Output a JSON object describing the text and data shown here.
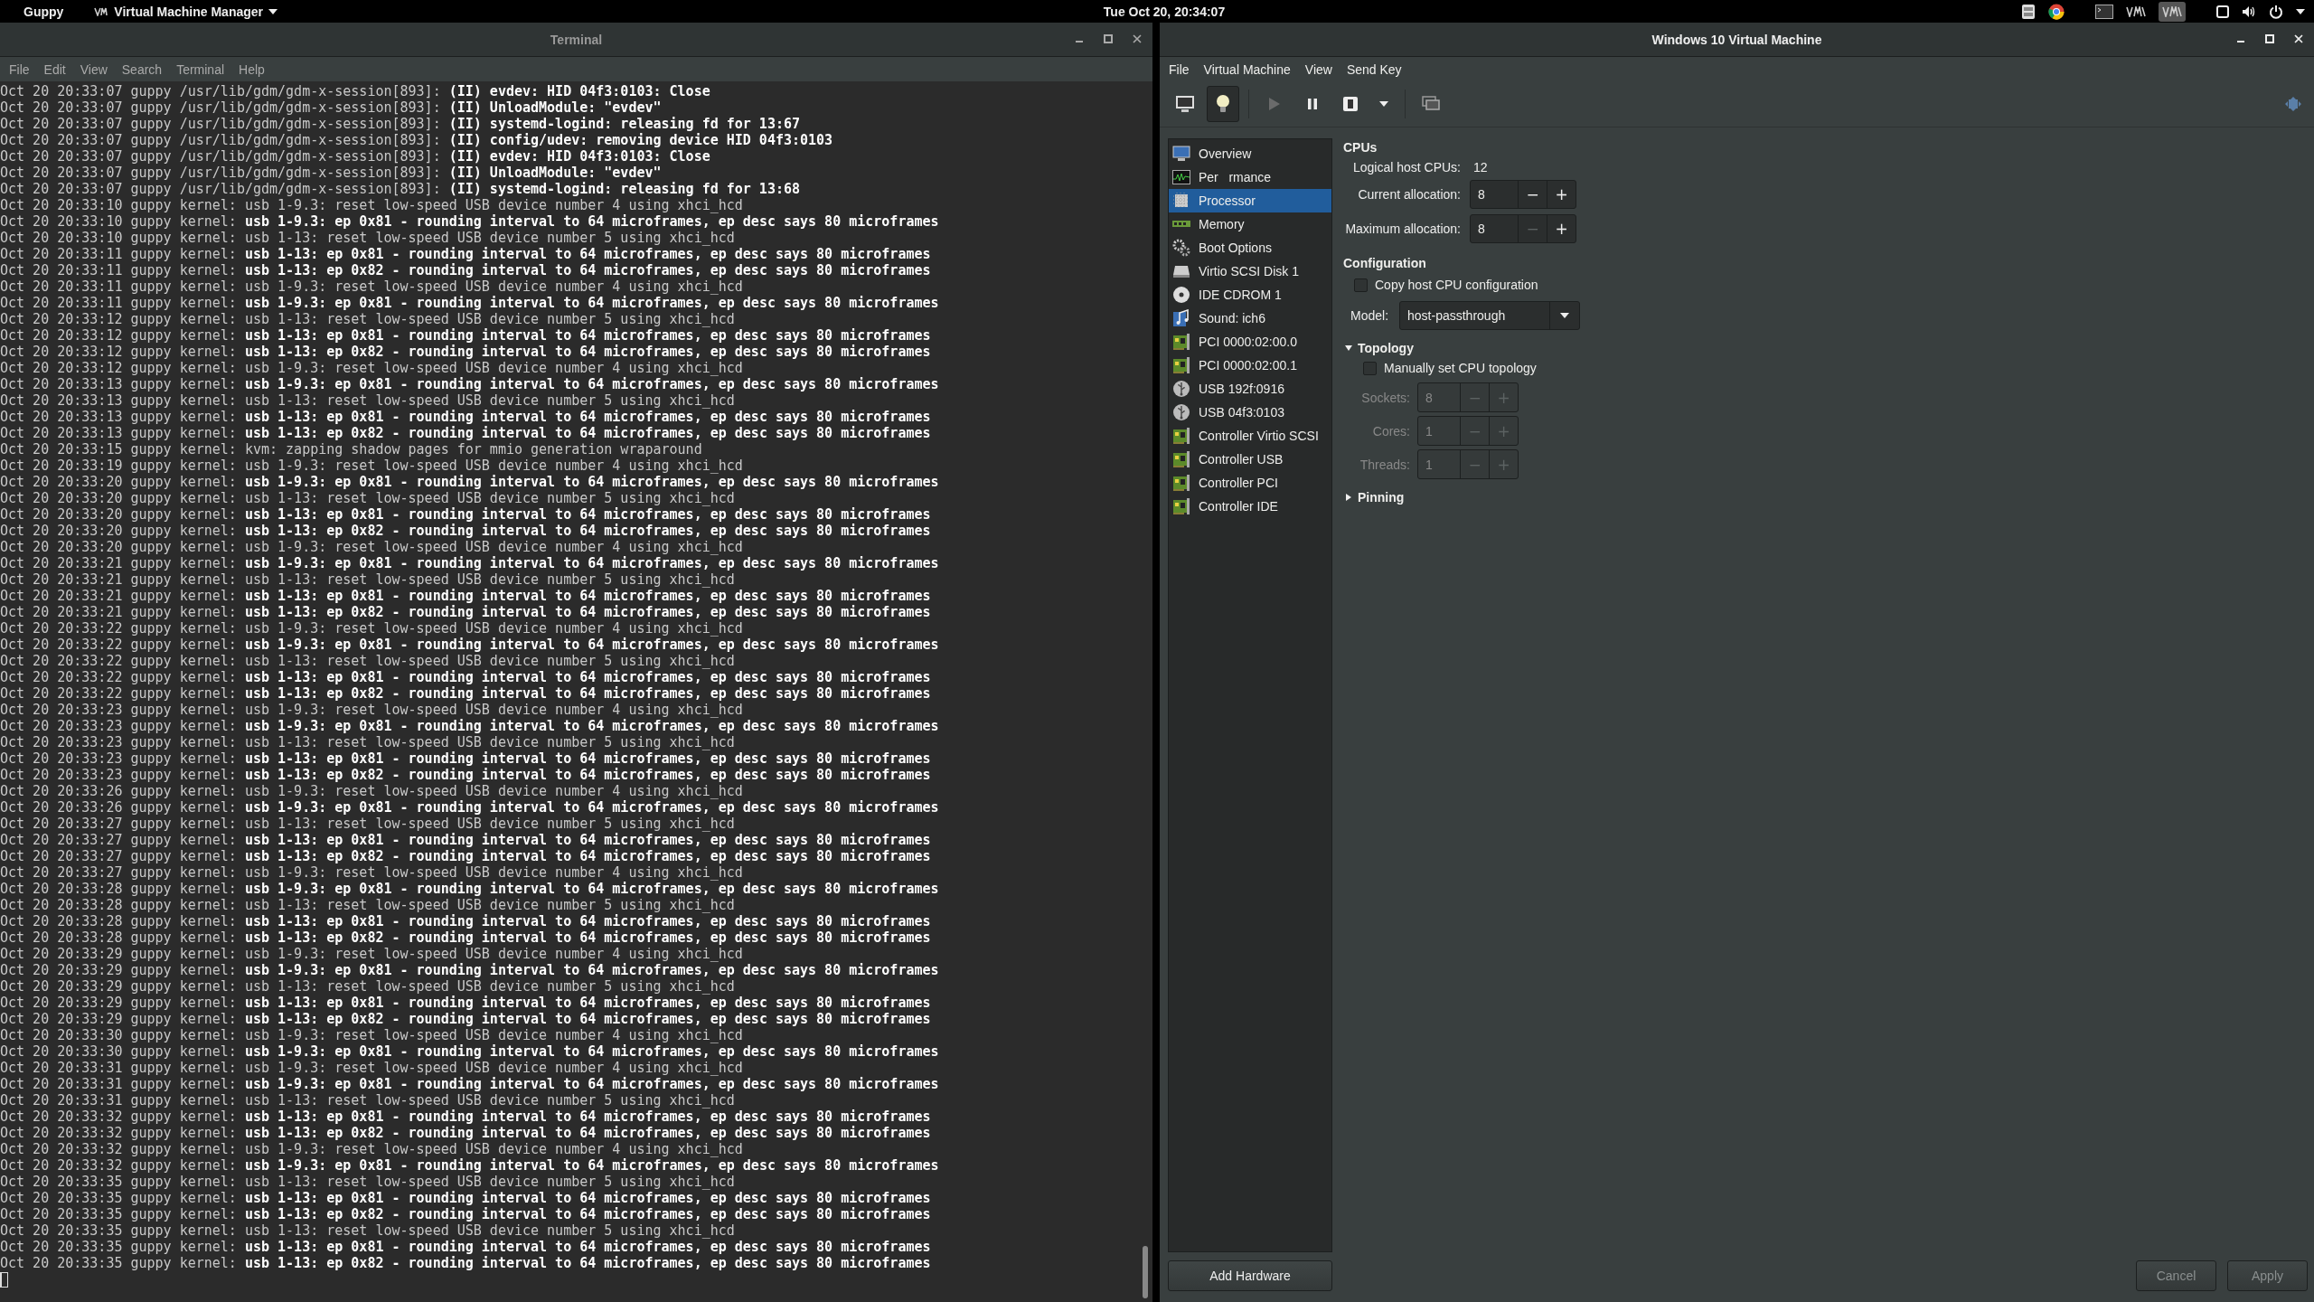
{
  "top_bar": {
    "activities": "Guppy",
    "app_menu": "Virtual Machine Manager",
    "clock": "Tue Oct 20, 20:34:07"
  },
  "terminal": {
    "title": "Terminal",
    "menu": [
      "File",
      "Edit",
      "View",
      "Search",
      "Terminal",
      "Help"
    ],
    "lines": [
      {
        "prefix": "Oct 20 20:33:07 guppy /usr/lib/gdm/gdm-x-session[893]:",
        "message": "(II) evdev: HID 04f3:0103: Close",
        "bold": true
      },
      {
        "prefix": "Oct 20 20:33:07 guppy /usr/lib/gdm/gdm-x-session[893]:",
        "message": "(II) UnloadModule: \"evdev\"",
        "bold": true
      },
      {
        "prefix": "Oct 20 20:33:07 guppy /usr/lib/gdm/gdm-x-session[893]:",
        "message": "(II) systemd-logind: releasing fd for 13:67",
        "bold": true
      },
      {
        "prefix": "Oct 20 20:33:07 guppy /usr/lib/gdm/gdm-x-session[893]:",
        "message": "(II) config/udev: removing device HID 04f3:0103",
        "bold": true
      },
      {
        "prefix": "Oct 20 20:33:07 guppy /usr/lib/gdm/gdm-x-session[893]:",
        "message": "(II) evdev: HID 04f3:0103: Close",
        "bold": true
      },
      {
        "prefix": "Oct 20 20:33:07 guppy /usr/lib/gdm/gdm-x-session[893]:",
        "message": "(II) UnloadModule: \"evdev\"",
        "bold": true
      },
      {
        "prefix": "Oct 20 20:33:07 guppy /usr/lib/gdm/gdm-x-session[893]:",
        "message": "(II) systemd-logind: releasing fd for 13:68",
        "bold": true
      },
      {
        "prefix": "Oct 20 20:33:10 guppy kernel:",
        "message": "usb 1-9.3: reset low-speed USB device number 4 using xhci_hcd",
        "bold": false
      },
      {
        "prefix": "Oct 20 20:33:10 guppy kernel:",
        "message": "usb 1-9.3: ep 0x81 - rounding interval to 64 microframes, ep desc says 80 microframes",
        "bold": true
      },
      {
        "prefix": "Oct 20 20:33:10 guppy kernel:",
        "message": "usb 1-13: reset low-speed USB device number 5 using xhci_hcd",
        "bold": false
      },
      {
        "prefix": "Oct 20 20:33:11 guppy kernel:",
        "message": "usb 1-13: ep 0x81 - rounding interval to 64 microframes, ep desc says 80 microframes",
        "bold": true
      },
      {
        "prefix": "Oct 20 20:33:11 guppy kernel:",
        "message": "usb 1-13: ep 0x82 - rounding interval to 64 microframes, ep desc says 80 microframes",
        "bold": true
      },
      {
        "prefix": "Oct 20 20:33:11 guppy kernel:",
        "message": "usb 1-9.3: reset low-speed USB device number 4 using xhci_hcd",
        "bold": false
      },
      {
        "prefix": "Oct 20 20:33:11 guppy kernel:",
        "message": "usb 1-9.3: ep 0x81 - rounding interval to 64 microframes, ep desc says 80 microframes",
        "bold": true
      },
      {
        "prefix": "Oct 20 20:33:12 guppy kernel:",
        "message": "usb 1-13: reset low-speed USB device number 5 using xhci_hcd",
        "bold": false
      },
      {
        "prefix": "Oct 20 20:33:12 guppy kernel:",
        "message": "usb 1-13: ep 0x81 - rounding interval to 64 microframes, ep desc says 80 microframes",
        "bold": true
      },
      {
        "prefix": "Oct 20 20:33:12 guppy kernel:",
        "message": "usb 1-13: ep 0x82 - rounding interval to 64 microframes, ep desc says 80 microframes",
        "bold": true
      },
      {
        "prefix": "Oct 20 20:33:12 guppy kernel:",
        "message": "usb 1-9.3: reset low-speed USB device number 4 using xhci_hcd",
        "bold": false
      },
      {
        "prefix": "Oct 20 20:33:13 guppy kernel:",
        "message": "usb 1-9.3: ep 0x81 - rounding interval to 64 microframes, ep desc says 80 microframes",
        "bold": true
      },
      {
        "prefix": "Oct 20 20:33:13 guppy kernel:",
        "message": "usb 1-13: reset low-speed USB device number 5 using xhci_hcd",
        "bold": false
      },
      {
        "prefix": "Oct 20 20:33:13 guppy kernel:",
        "message": "usb 1-13: ep 0x81 - rounding interval to 64 microframes, ep desc says 80 microframes",
        "bold": true
      },
      {
        "prefix": "Oct 20 20:33:13 guppy kernel:",
        "message": "usb 1-13: ep 0x82 - rounding interval to 64 microframes, ep desc says 80 microframes",
        "bold": true
      },
      {
        "prefix": "Oct 20 20:33:15 guppy kernel:",
        "message": "kvm: zapping shadow pages for mmio generation wraparound",
        "bold": false
      },
      {
        "prefix": "Oct 20 20:33:19 guppy kernel:",
        "message": "usb 1-9.3: reset low-speed USB device number 4 using xhci_hcd",
        "bold": false
      },
      {
        "prefix": "Oct 20 20:33:20 guppy kernel:",
        "message": "usb 1-9.3: ep 0x81 - rounding interval to 64 microframes, ep desc says 80 microframes",
        "bold": true
      },
      {
        "prefix": "Oct 20 20:33:20 guppy kernel:",
        "message": "usb 1-13: reset low-speed USB device number 5 using xhci_hcd",
        "bold": false
      },
      {
        "prefix": "Oct 20 20:33:20 guppy kernel:",
        "message": "usb 1-13: ep 0x81 - rounding interval to 64 microframes, ep desc says 80 microframes",
        "bold": true
      },
      {
        "prefix": "Oct 20 20:33:20 guppy kernel:",
        "message": "usb 1-13: ep 0x82 - rounding interval to 64 microframes, ep desc says 80 microframes",
        "bold": true
      },
      {
        "prefix": "Oct 20 20:33:20 guppy kernel:",
        "message": "usb 1-9.3: reset low-speed USB device number 4 using xhci_hcd",
        "bold": false
      },
      {
        "prefix": "Oct 20 20:33:21 guppy kernel:",
        "message": "usb 1-9.3: ep 0x81 - rounding interval to 64 microframes, ep desc says 80 microframes",
        "bold": true
      },
      {
        "prefix": "Oct 20 20:33:21 guppy kernel:",
        "message": "usb 1-13: reset low-speed USB device number 5 using xhci_hcd",
        "bold": false
      },
      {
        "prefix": "Oct 20 20:33:21 guppy kernel:",
        "message": "usb 1-13: ep 0x81 - rounding interval to 64 microframes, ep desc says 80 microframes",
        "bold": true
      },
      {
        "prefix": "Oct 20 20:33:21 guppy kernel:",
        "message": "usb 1-13: ep 0x82 - rounding interval to 64 microframes, ep desc says 80 microframes",
        "bold": true
      },
      {
        "prefix": "Oct 20 20:33:22 guppy kernel:",
        "message": "usb 1-9.3: reset low-speed USB device number 4 using xhci_hcd",
        "bold": false
      },
      {
        "prefix": "Oct 20 20:33:22 guppy kernel:",
        "message": "usb 1-9.3: ep 0x81 - rounding interval to 64 microframes, ep desc says 80 microframes",
        "bold": true
      },
      {
        "prefix": "Oct 20 20:33:22 guppy kernel:",
        "message": "usb 1-13: reset low-speed USB device number 5 using xhci_hcd",
        "bold": false
      },
      {
        "prefix": "Oct 20 20:33:22 guppy kernel:",
        "message": "usb 1-13: ep 0x81 - rounding interval to 64 microframes, ep desc says 80 microframes",
        "bold": true
      },
      {
        "prefix": "Oct 20 20:33:22 guppy kernel:",
        "message": "usb 1-13: ep 0x82 - rounding interval to 64 microframes, ep desc says 80 microframes",
        "bold": true
      },
      {
        "prefix": "Oct 20 20:33:23 guppy kernel:",
        "message": "usb 1-9.3: reset low-speed USB device number 4 using xhci_hcd",
        "bold": false
      },
      {
        "prefix": "Oct 20 20:33:23 guppy kernel:",
        "message": "usb 1-9.3: ep 0x81 - rounding interval to 64 microframes, ep desc says 80 microframes",
        "bold": true
      },
      {
        "prefix": "Oct 20 20:33:23 guppy kernel:",
        "message": "usb 1-13: reset low-speed USB device number 5 using xhci_hcd",
        "bold": false
      },
      {
        "prefix": "Oct 20 20:33:23 guppy kernel:",
        "message": "usb 1-13: ep 0x81 - rounding interval to 64 microframes, ep desc says 80 microframes",
        "bold": true
      },
      {
        "prefix": "Oct 20 20:33:23 guppy kernel:",
        "message": "usb 1-13: ep 0x82 - rounding interval to 64 microframes, ep desc says 80 microframes",
        "bold": true
      },
      {
        "prefix": "Oct 20 20:33:26 guppy kernel:",
        "message": "usb 1-9.3: reset low-speed USB device number 4 using xhci_hcd",
        "bold": false
      },
      {
        "prefix": "Oct 20 20:33:26 guppy kernel:",
        "message": "usb 1-9.3: ep 0x81 - rounding interval to 64 microframes, ep desc says 80 microframes",
        "bold": true
      },
      {
        "prefix": "Oct 20 20:33:27 guppy kernel:",
        "message": "usb 1-13: reset low-speed USB device number 5 using xhci_hcd",
        "bold": false
      },
      {
        "prefix": "Oct 20 20:33:27 guppy kernel:",
        "message": "usb 1-13: ep 0x81 - rounding interval to 64 microframes, ep desc says 80 microframes",
        "bold": true
      },
      {
        "prefix": "Oct 20 20:33:27 guppy kernel:",
        "message": "usb 1-13: ep 0x82 - rounding interval to 64 microframes, ep desc says 80 microframes",
        "bold": true
      },
      {
        "prefix": "Oct 20 20:33:27 guppy kernel:",
        "message": "usb 1-9.3: reset low-speed USB device number 4 using xhci_hcd",
        "bold": false
      },
      {
        "prefix": "Oct 20 20:33:28 guppy kernel:",
        "message": "usb 1-9.3: ep 0x81 - rounding interval to 64 microframes, ep desc says 80 microframes",
        "bold": true
      },
      {
        "prefix": "Oct 20 20:33:28 guppy kernel:",
        "message": "usb 1-13: reset low-speed USB device number 5 using xhci_hcd",
        "bold": false
      },
      {
        "prefix": "Oct 20 20:33:28 guppy kernel:",
        "message": "usb 1-13: ep 0x81 - rounding interval to 64 microframes, ep desc says 80 microframes",
        "bold": true
      },
      {
        "prefix": "Oct 20 20:33:28 guppy kernel:",
        "message": "usb 1-13: ep 0x82 - rounding interval to 64 microframes, ep desc says 80 microframes",
        "bold": true
      },
      {
        "prefix": "Oct 20 20:33:29 guppy kernel:",
        "message": "usb 1-9.3: reset low-speed USB device number 4 using xhci_hcd",
        "bold": false
      },
      {
        "prefix": "Oct 20 20:33:29 guppy kernel:",
        "message": "usb 1-9.3: ep 0x81 - rounding interval to 64 microframes, ep desc says 80 microframes",
        "bold": true
      },
      {
        "prefix": "Oct 20 20:33:29 guppy kernel:",
        "message": "usb 1-13: reset low-speed USB device number 5 using xhci_hcd",
        "bold": false
      },
      {
        "prefix": "Oct 20 20:33:29 guppy kernel:",
        "message": "usb 1-13: ep 0x81 - rounding interval to 64 microframes, ep desc says 80 microframes",
        "bold": true
      },
      {
        "prefix": "Oct 20 20:33:29 guppy kernel:",
        "message": "usb 1-13: ep 0x82 - rounding interval to 64 microframes, ep desc says 80 microframes",
        "bold": true
      },
      {
        "prefix": "Oct 20 20:33:30 guppy kernel:",
        "message": "usb 1-9.3: reset low-speed USB device number 4 using xhci_hcd",
        "bold": false
      },
      {
        "prefix": "Oct 20 20:33:30 guppy kernel:",
        "message": "usb 1-9.3: ep 0x81 - rounding interval to 64 microframes, ep desc says 80 microframes",
        "bold": true
      },
      {
        "prefix": "Oct 20 20:33:31 guppy kernel:",
        "message": "usb 1-9.3: reset low-speed USB device number 4 using xhci_hcd",
        "bold": false
      },
      {
        "prefix": "Oct 20 20:33:31 guppy kernel:",
        "message": "usb 1-9.3: ep 0x81 - rounding interval to 64 microframes, ep desc says 80 microframes",
        "bold": true
      },
      {
        "prefix": "Oct 20 20:33:31 guppy kernel:",
        "message": "usb 1-13: reset low-speed USB device number 5 using xhci_hcd",
        "bold": false
      },
      {
        "prefix": "Oct 20 20:33:32 guppy kernel:",
        "message": "usb 1-13: ep 0x81 - rounding interval to 64 microframes, ep desc says 80 microframes",
        "bold": true
      },
      {
        "prefix": "Oct 20 20:33:32 guppy kernel:",
        "message": "usb 1-13: ep 0x82 - rounding interval to 64 microframes, ep desc says 80 microframes",
        "bold": true
      },
      {
        "prefix": "Oct 20 20:33:32 guppy kernel:",
        "message": "usb 1-9.3: reset low-speed USB device number 4 using xhci_hcd",
        "bold": false
      },
      {
        "prefix": "Oct 20 20:33:32 guppy kernel:",
        "message": "usb 1-9.3: ep 0x81 - rounding interval to 64 microframes, ep desc says 80 microframes",
        "bold": true
      },
      {
        "prefix": "Oct 20 20:33:35 guppy kernel:",
        "message": "usb 1-13: reset low-speed USB device number 5 using xhci_hcd",
        "bold": false
      },
      {
        "prefix": "Oct 20 20:33:35 guppy kernel:",
        "message": "usb 1-13: ep 0x81 - rounding interval to 64 microframes, ep desc says 80 microframes",
        "bold": true
      },
      {
        "prefix": "Oct 20 20:33:35 guppy kernel:",
        "message": "usb 1-13: ep 0x82 - rounding interval to 64 microframes, ep desc says 80 microframes",
        "bold": true
      },
      {
        "prefix": "Oct 20 20:33:35 guppy kernel:",
        "message": "usb 1-13: reset low-speed USB device number 5 using xhci_hcd",
        "bold": false
      },
      {
        "prefix": "Oct 20 20:33:35 guppy kernel:",
        "message": "usb 1-13: ep 0x81 - rounding interval to 64 microframes, ep desc says 80 microframes",
        "bold": true
      },
      {
        "prefix": "Oct 20 20:33:35 guppy kernel:",
        "message": "usb 1-13: ep 0x82 - rounding interval to 64 microframes, ep desc says 80 microframes",
        "bold": true
      }
    ]
  },
  "vm_window": {
    "title": "Windows 10 Virtual Machine",
    "menu": [
      "File",
      "Virtual Machine",
      "View",
      "Send Key"
    ],
    "toolbar": [
      {
        "kind": "console",
        "selected": false,
        "disabled": false
      },
      {
        "kind": "details",
        "selected": true,
        "disabled": false
      },
      {
        "kind": "run",
        "selected": false,
        "disabled": true
      },
      {
        "kind": "pause",
        "selected": false,
        "disabled": false
      },
      {
        "kind": "shutdown",
        "selected": false,
        "disabled": false
      },
      {
        "kind": "shutdown_menu",
        "selected": false,
        "disabled": false
      },
      {
        "kind": "snapshots",
        "selected": false,
        "disabled": false
      }
    ],
    "hardware": [
      {
        "label": "Overview",
        "kind": "overview",
        "selected": false
      },
      {
        "label": "Per   rmance",
        "kind": "performance",
        "selected": false
      },
      {
        "label": "Processor",
        "kind": "processor",
        "selected": true
      },
      {
        "label": "Memory",
        "kind": "memory",
        "selected": false
      },
      {
        "label": "Boot Options",
        "kind": "boot",
        "selected": false
      },
      {
        "label": "Virtio SCSI Disk 1",
        "kind": "disk",
        "selected": false
      },
      {
        "label": "IDE CDROM 1",
        "kind": "cdrom",
        "selected": false
      },
      {
        "label": "Sound: ich6",
        "kind": "sound",
        "selected": false
      },
      {
        "label": "PCI 0000:02:00.0",
        "kind": "pci",
        "selected": false
      },
      {
        "label": "PCI 0000:02:00.1",
        "kind": "pci",
        "selected": false
      },
      {
        "label": "USB 192f:0916",
        "kind": "usb",
        "selected": false
      },
      {
        "label": "USB 04f3:0103",
        "kind": "usb",
        "selected": false
      },
      {
        "label": "Controller Virtio SCSI",
        "kind": "controller",
        "selected": false
      },
      {
        "label": "Controller USB",
        "kind": "controller",
        "selected": false
      },
      {
        "label": "Controller PCI",
        "kind": "controller",
        "selected": false
      },
      {
        "label": "Controller IDE",
        "kind": "controller",
        "selected": false
      }
    ],
    "add_hardware": "Add Hardware",
    "processor": {
      "cpus_heading": "CPUs",
      "logical": {
        "label": "Logical host CPUs:",
        "value": "12"
      },
      "allocations": [
        {
          "label": "Current allocation:",
          "value": "8",
          "minus": {
            "glyph": "−",
            "disabled": false
          },
          "plus": {
            "glyph": "+",
            "disabled": false
          }
        },
        {
          "label": "Maximum allocation:",
          "value": "8",
          "minus": {
            "glyph": "−",
            "disabled": true
          },
          "plus": {
            "glyph": "+",
            "disabled": false
          }
        }
      ],
      "configuration": {
        "heading": "Configuration",
        "copy_host": {
          "label": "Copy host CPU configuration",
          "checked": false
        },
        "model": {
          "label": "Model:",
          "value": "host-passthrough"
        }
      },
      "topology": {
        "label": "Topology",
        "expanded": true,
        "manual": {
          "label": "Manually set CPU topology",
          "checked": false
        },
        "fields": [
          {
            "label": "Sockets:",
            "value": "8",
            "disabled": true,
            "minus": {
              "glyph": "−",
              "disabled": true
            },
            "plus": {
              "glyph": "+",
              "disabled": true
            }
          },
          {
            "label": "Cores:",
            "value": "1",
            "disabled": true,
            "minus": {
              "glyph": "−",
              "disabled": true
            },
            "plus": {
              "glyph": "+",
              "disabled": true
            }
          },
          {
            "label": "Threads:",
            "value": "1",
            "disabled": true,
            "minus": {
              "glyph": "−",
              "disabled": true
            },
            "plus": {
              "glyph": "+",
              "disabled": true
            }
          }
        ]
      },
      "pinning": {
        "label": "Pinning",
        "expanded": false
      }
    },
    "buttons": [
      {
        "label": "Cancel",
        "disabled": true
      },
      {
        "label": "Apply",
        "disabled": true
      }
    ]
  }
}
